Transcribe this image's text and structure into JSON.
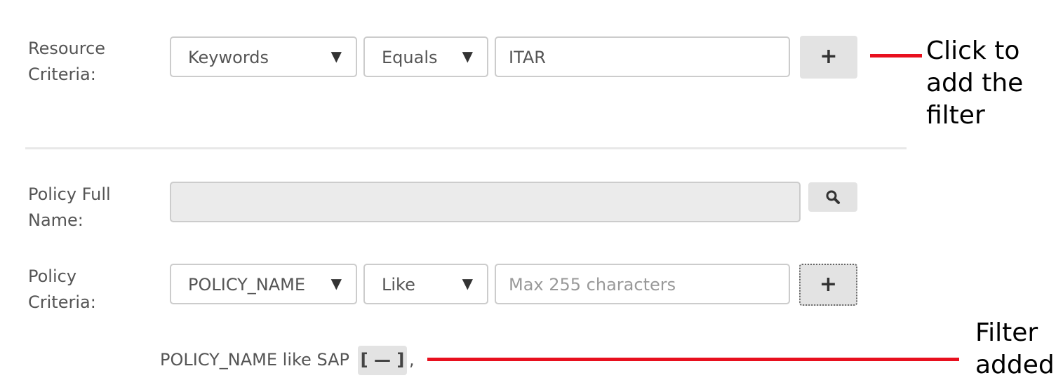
{
  "resource_criteria": {
    "label": "Resource\nCriteria:",
    "field_select": "Keywords",
    "operator_select": "Equals",
    "value": "ITAR",
    "add_button": "+"
  },
  "policy_full_name": {
    "label": "Policy Full\nName:",
    "value": "",
    "search_icon": "search-icon"
  },
  "policy_criteria": {
    "label": "Policy\nCriteria:",
    "field_select": "POLICY_NAME",
    "operator_select": "Like",
    "placeholder": "Max 255 characters",
    "add_button": "+"
  },
  "added_filter": {
    "text": "POLICY_NAME like SAP",
    "remove_button": "[ — ]",
    "separator": ","
  },
  "caret_glyph": "▼",
  "annotations": {
    "add_filter_callout": "Click to\nadd the\nfilter",
    "filter_added_callout": "Filter\nadded"
  },
  "colors": {
    "callout_line": "#e8101e",
    "button_bg": "#e3e3e3",
    "input_border": "#cccccc",
    "disabled_bg": "#ebebeb"
  }
}
